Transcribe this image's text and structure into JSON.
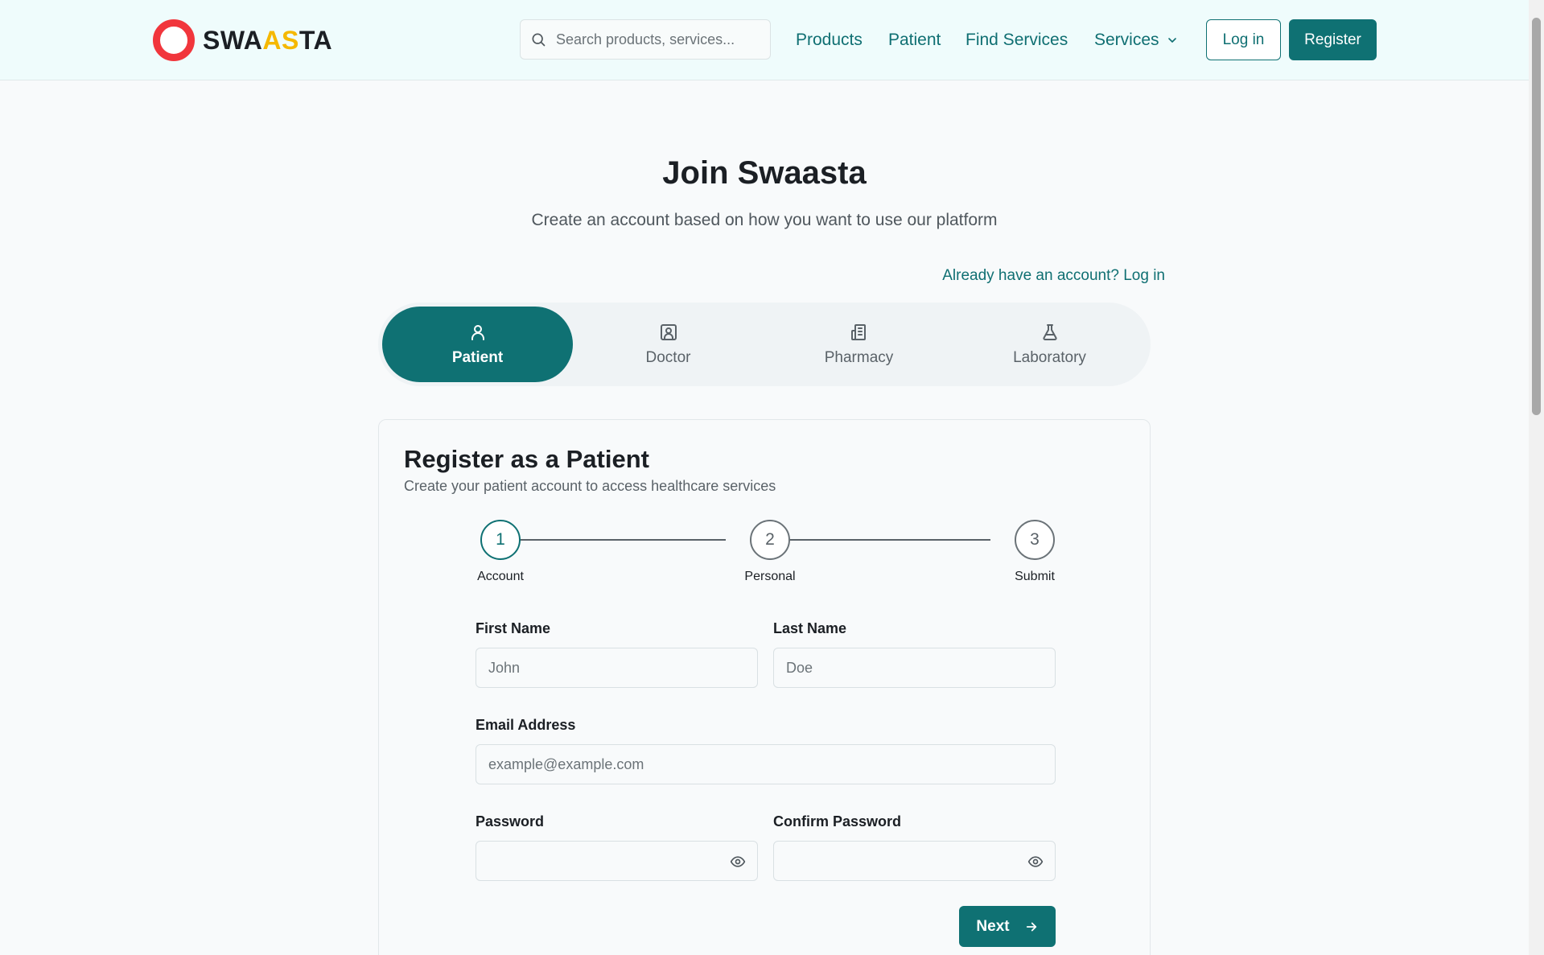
{
  "header": {
    "logo": {
      "part1": "SWA",
      "part2": "AS",
      "part3": "TA"
    },
    "search_placeholder": "Search products, services...",
    "nav": [
      "Products",
      "Patient",
      "Find Services",
      "Services"
    ],
    "login_label": "Log in",
    "register_label": "Register"
  },
  "hero": {
    "title": "Join Swaasta",
    "subtitle": "Create an account based on how you want to use our platform",
    "login_link": "Already have an account? Log in"
  },
  "roles": [
    {
      "label": "Patient",
      "icon": "user-icon",
      "active": true
    },
    {
      "label": "Doctor",
      "icon": "doctor-badge-icon",
      "active": false
    },
    {
      "label": "Pharmacy",
      "icon": "pharmacy-building-icon",
      "active": false
    },
    {
      "label": "Laboratory",
      "icon": "flask-icon",
      "active": false
    }
  ],
  "form": {
    "title": "Register as a Patient",
    "subtitle": "Create your patient account to access healthcare services",
    "steps": [
      {
        "number": "1",
        "label": "Account",
        "active": true
      },
      {
        "number": "2",
        "label": "Personal",
        "active": false
      },
      {
        "number": "3",
        "label": "Submit",
        "active": false
      }
    ],
    "fields": {
      "first_name": {
        "label": "First Name",
        "placeholder": "John",
        "value": ""
      },
      "last_name": {
        "label": "Last Name",
        "placeholder": "Doe",
        "value": ""
      },
      "email": {
        "label": "Email Address",
        "placeholder": "example@example.com",
        "value": ""
      },
      "password": {
        "label": "Password",
        "placeholder": "",
        "value": ""
      },
      "confirm_password": {
        "label": "Confirm Password",
        "placeholder": "",
        "value": ""
      }
    },
    "next_label": "Next"
  },
  "colors": {
    "accent": "#0f7173",
    "header_bg": "#effcfc",
    "logo_red": "#f1363c",
    "logo_yellow": "#f5b800"
  }
}
